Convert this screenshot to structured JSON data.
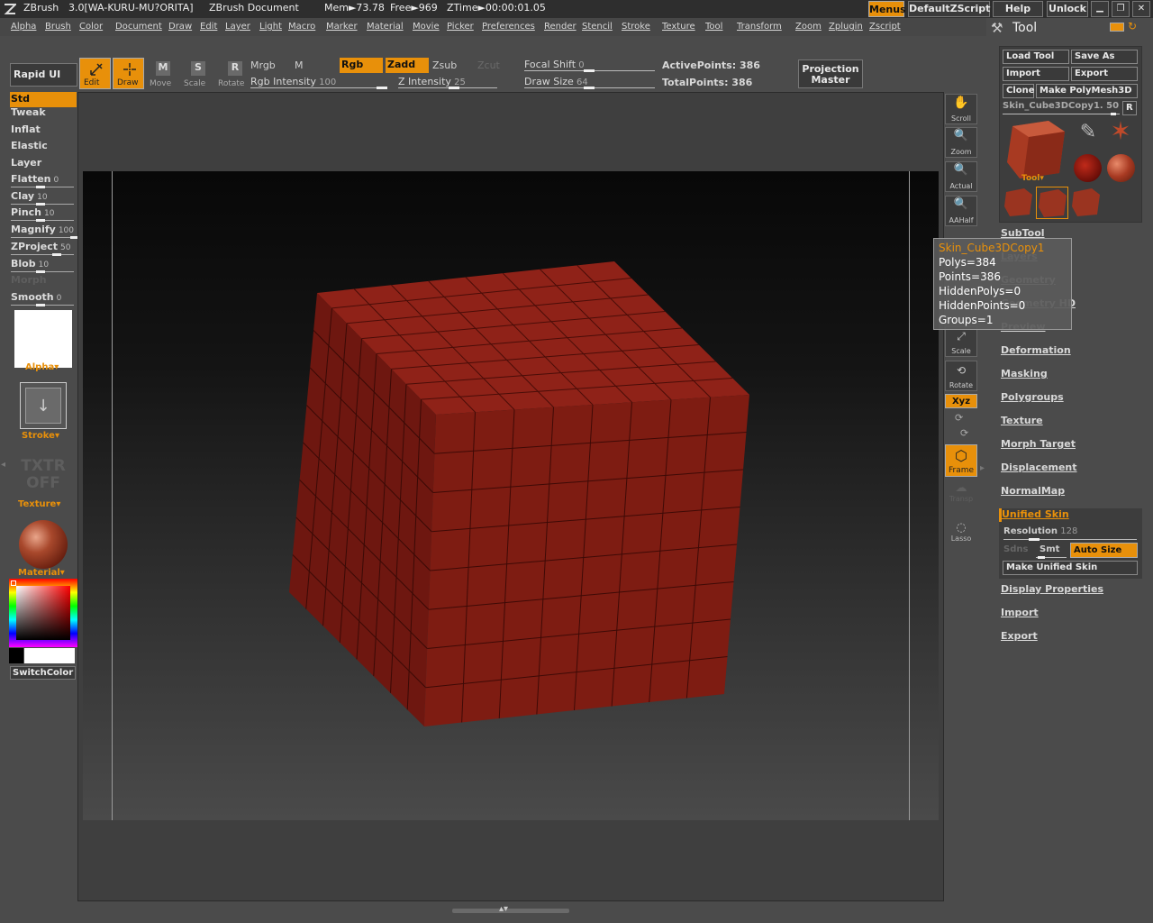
{
  "titlebar": {
    "app": "ZBrush",
    "version": "3.0[WA-KURU-MU?ORITA]",
    "document": "ZBrush Document",
    "mem": "Mem►73.78",
    "free": "Free►969",
    "ztime": "ZTime►00:00:01.05",
    "menus": "Menus",
    "default_zscript": "DefaultZScript",
    "help": "Help",
    "unlock": "Unlock"
  },
  "menubar": [
    "Alpha",
    "Brush",
    "Color",
    "Document",
    "Draw",
    "Edit",
    "Layer",
    "Light",
    "Macro",
    "Marker",
    "Material",
    "Movie",
    "Picker",
    "Preferences",
    "Render",
    "Stencil",
    "Stroke",
    "Texture",
    "Tool",
    "Transform",
    "Zoom",
    "Zplugin",
    "Zscript"
  ],
  "toolbar": {
    "rapid_ui": "Rapid UI",
    "edit": "Edit",
    "draw": "Draw",
    "move": "Move",
    "scale": "Scale",
    "rotate": "Rotate",
    "mrgb": "Mrgb",
    "m": "M",
    "rgb": "Rgb",
    "zadd": "Zadd",
    "zsub": "Zsub",
    "zcut": "Zcut",
    "rgb_intensity": "Rgb Intensity",
    "rgb_intensity_value": "100",
    "z_intensity": "Z Intensity",
    "z_intensity_value": "25",
    "focal_shift": "Focal Shift",
    "focal_shift_value": "0",
    "draw_size": "Draw Size",
    "draw_size_value": "64",
    "active_points": "ActivePoints: 386",
    "total_points": "TotalPoints: 386",
    "projection_master_1": "Projection",
    "projection_master_2": "Master"
  },
  "leftpanel": {
    "items": [
      {
        "label": "Std",
        "value": ""
      },
      {
        "label": "Tweak",
        "value": ""
      },
      {
        "label": "Inflat",
        "value": ""
      },
      {
        "label": "Elastic",
        "value": ""
      },
      {
        "label": "Layer",
        "value": ""
      },
      {
        "label": "Flatten",
        "value": "0"
      },
      {
        "label": "Clay",
        "value": "10"
      },
      {
        "label": "Pinch",
        "value": "10"
      },
      {
        "label": "Magnify",
        "value": "100"
      },
      {
        "label": "ZProject",
        "value": "50"
      },
      {
        "label": "Blob",
        "value": "10"
      },
      {
        "label": "Morph",
        "value": ""
      },
      {
        "label": "Smooth",
        "value": "0"
      }
    ],
    "alpha": "Alpha",
    "stroke": "Stroke",
    "txtr_1": "TXTR",
    "txtr_2": "OFF",
    "texture": "Texture",
    "material": "Material",
    "switch_color": "SwitchColor"
  },
  "righttools": {
    "scroll": "Scroll",
    "zoom": "Zoom",
    "actual": "Actual",
    "aahalf": "AAHalf",
    "scale": "Scale",
    "rotate": "Rotate",
    "xyz": "Xyz",
    "frame": "Frame",
    "transp": "Transp",
    "lasso": "Lasso"
  },
  "toolpanel": {
    "title": "Tool",
    "load_tool": "Load Tool",
    "save_as": "Save As",
    "import": "Import",
    "export": "Export",
    "clone": "Clone",
    "make_polymesh": "Make PolyMesh3D",
    "current_tool": "Skin_Cube3DCopy1. 50",
    "r": "R",
    "tool_label": "Tool",
    "sections": [
      "SubTool",
      "Layers",
      "Geometry",
      "Geometry HD",
      "Preview",
      "Deformation",
      "Masking",
      "Polygroups",
      "Texture",
      "Morph Target",
      "Displacement",
      "NormalMap"
    ],
    "unified_skin": "Unified Skin",
    "resolution": "Resolution",
    "resolution_value": "128",
    "sdns": "Sdns",
    "smt": "Smt",
    "auto_size": "Auto Size",
    "make_unified_skin": "Make Unified Skin",
    "bottom_sections": [
      "Display Properties",
      "Import",
      "Export"
    ]
  },
  "tooltip": {
    "name": "Skin_Cube3DCopy1",
    "polys": "Polys=384",
    "points": "Points=386",
    "hidden_polys": "HiddenPolys=0",
    "hidden_points": "HiddenPoints=0",
    "groups": "Groups=1"
  },
  "colors": {
    "accent": "#e8900a",
    "mesh": "#8a1a10",
    "panel": "#4b4b4b"
  }
}
